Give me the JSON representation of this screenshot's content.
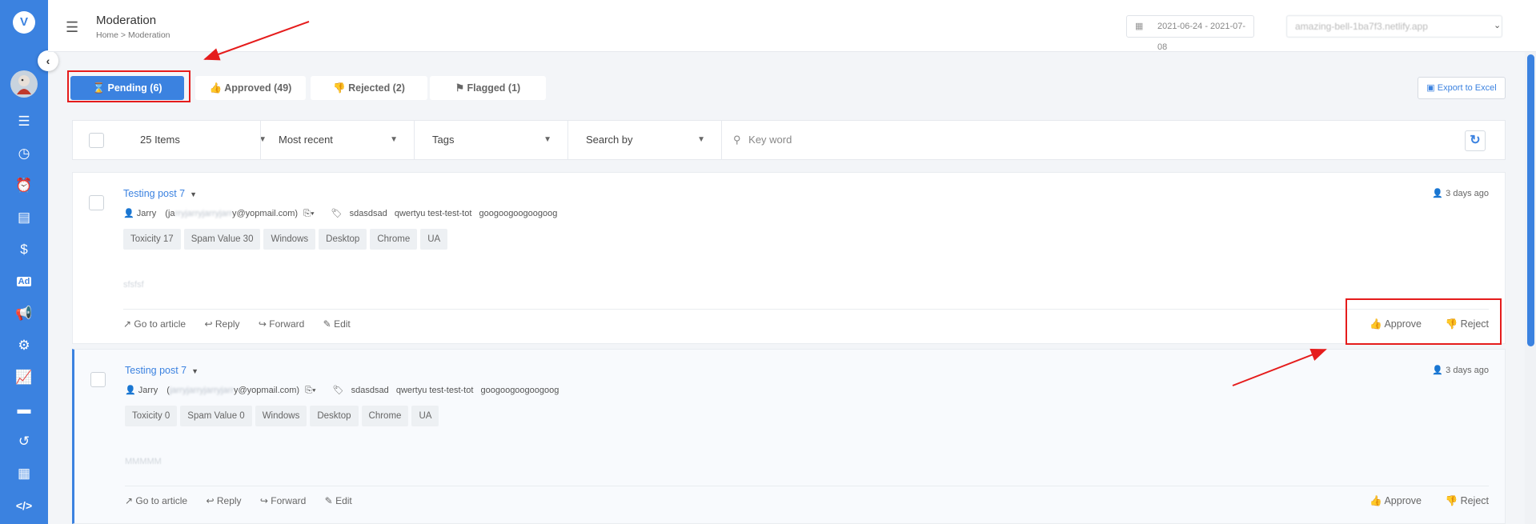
{
  "sidebar": {
    "logo": "V",
    "items": [
      "list-icon",
      "clock-icon",
      "alarm-icon",
      "book-icon",
      "dollar-icon",
      "ad-icon",
      "megaphone-icon",
      "gear-icon",
      "chart-icon",
      "card-icon",
      "history-icon",
      "table-icon",
      "code-icon"
    ],
    "active_index": 6
  },
  "header": {
    "title": "Moderation",
    "breadcrumb": "Home  >  Moderation",
    "date_range": "2021-06-24 - 2021-07-08",
    "site": "amazing-bell-1ba7f3.netlify.app"
  },
  "tabs": [
    {
      "label": "Pending (6)",
      "icon": "hourglass-icon",
      "active": true
    },
    {
      "label": "Approved (49)",
      "icon": "thumbs-up-icon",
      "active": false
    },
    {
      "label": "Rejected (2)",
      "icon": "thumbs-down-icon",
      "active": false
    },
    {
      "label": "Flagged (1)",
      "icon": "flag-icon",
      "active": false
    }
  ],
  "export_label": "Export to Excel",
  "filters": {
    "items": "25 Items",
    "sort": "Most recent",
    "tags": "Tags",
    "search_by": "Search by",
    "keyword_placeholder": "Key word"
  },
  "posts": [
    {
      "title": "Testing post 7",
      "time": "3 days ago",
      "author": "Jarry",
      "email_prefix": "(ja",
      "email_hidden": "rryjarryjarryjarr",
      "email_suffix": "y@yopmail.com)",
      "tags": [
        "sdasdsad",
        "qwertyu test-test-tot",
        "googoogoogoogoog"
      ],
      "chips": [
        "Toxicity 17",
        "Spam Value 30",
        "Windows",
        "Desktop",
        "Chrome",
        "UA"
      ],
      "body": "sfsfsf",
      "actions": [
        "Go to article",
        "Reply",
        "Forward",
        "Edit"
      ],
      "approve": "Approve",
      "reject": "Reject"
    },
    {
      "title": "Testing post 7",
      "time": "3 days ago",
      "author": "Jarry",
      "email_prefix": "(",
      "email_hidden": "jarryjarryjarryjarr",
      "email_suffix": "y@yopmail.com)",
      "tags": [
        "sdasdsad",
        "qwertyu test-test-tot",
        "googoogoogoogoog"
      ],
      "chips": [
        "Toxicity 0",
        "Spam Value 0",
        "Windows",
        "Desktop",
        "Chrome",
        "UA"
      ],
      "body": "MMMMM",
      "actions": [
        "Go to article",
        "Reply",
        "Forward",
        "Edit"
      ],
      "approve": "Approve",
      "reject": "Reject"
    }
  ],
  "colors": {
    "accent": "#3b82e0",
    "highlight": "#e51c1c"
  }
}
